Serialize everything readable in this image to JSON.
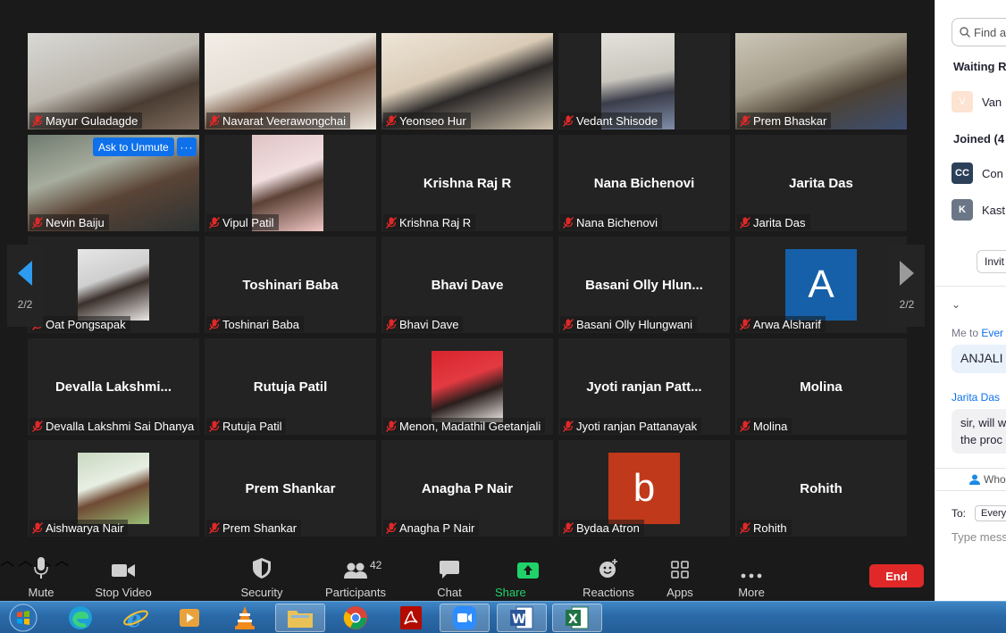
{
  "meeting": {
    "ask_to_unmute": "Ask to Unmute",
    "more_dots": "···",
    "page_left": "2/2",
    "page_right": "2/2"
  },
  "tiles": [
    {
      "name": "Mayur Guladagde",
      "big": "",
      "kind": "video"
    },
    {
      "name": "Navarat Veerawongchai",
      "big": "",
      "kind": "video"
    },
    {
      "name": "Yeonseo Hur",
      "big": "",
      "kind": "video"
    },
    {
      "name": "Vedant Shisode",
      "big": "",
      "kind": "video"
    },
    {
      "name": "Prem Bhaskar",
      "big": "",
      "kind": "video"
    },
    {
      "name": "Nevin Baiju",
      "big": "",
      "kind": "video"
    },
    {
      "name": "Vipul Patil",
      "big": "",
      "kind": "photo"
    },
    {
      "name": "Krishna Raj R",
      "big": "Krishna Raj R",
      "kind": "text"
    },
    {
      "name": "Nana Bichenovi",
      "big": "Nana Bichenovi",
      "kind": "text"
    },
    {
      "name": "Jarita Das",
      "big": "Jarita Das",
      "kind": "text"
    },
    {
      "name": "Oat Pongsapak",
      "big": "",
      "kind": "photo"
    },
    {
      "name": "Toshinari Baba",
      "big": "Toshinari Baba",
      "kind": "text"
    },
    {
      "name": "Bhavi Dave",
      "big": "Bhavi Dave",
      "kind": "text"
    },
    {
      "name": "Basani Olly Hlungwani",
      "big": "Basani  Olly  Hlun...",
      "kind": "text"
    },
    {
      "name": "Arwa Alsharif",
      "big": "A",
      "kind": "letter",
      "color": "#1560a8"
    },
    {
      "name": "Devalla Lakshmi Sai Dhanya",
      "big": "Devalla  Lakshmi...",
      "kind": "text"
    },
    {
      "name": "Rutuja Patil",
      "big": "Rutuja Patil",
      "kind": "text"
    },
    {
      "name": "Menon, Madathil Geetanjali",
      "big": "",
      "kind": "photo"
    },
    {
      "name": "Jyoti ranjan Pattanayak",
      "big": "Jyoti  ranjan  Patt...",
      "kind": "text"
    },
    {
      "name": "Molina",
      "big": "Molina",
      "kind": "text"
    },
    {
      "name": "Aishwarya Nair",
      "big": "",
      "kind": "photo"
    },
    {
      "name": "Prem Shankar",
      "big": "Prem Shankar",
      "kind": "text"
    },
    {
      "name": "Anagha P Nair",
      "big": "Anagha P Nair",
      "kind": "text"
    },
    {
      "name": "Bydaa Atron",
      "big": "b",
      "kind": "letter",
      "color": "#c0391b"
    },
    {
      "name": "Rohith",
      "big": "Rohith",
      "kind": "text"
    }
  ],
  "toolbar": {
    "mute": "Mute",
    "stop_video": "Stop Video",
    "security": "Security",
    "participants": "Participants",
    "participants_count": "42",
    "chat": "Chat",
    "share_screen": "Share Screen",
    "reactions": "Reactions",
    "apps": "Apps",
    "more": "More",
    "end": "End",
    "share_color": "#1fd36a",
    "end_color": "#e02828"
  },
  "panel": {
    "search_placeholder": "Find a",
    "waiting_heading": "Waiting R",
    "waiting_user": "Van",
    "joined_heading": "Joined (4",
    "joined": [
      {
        "initials": "CC",
        "name": "Con",
        "color": "#2d4059"
      },
      {
        "initials": "K",
        "name": "Kast",
        "color": "#6b7787"
      }
    ],
    "invite": "Invit",
    "msg1_from": "Me to",
    "msg1_to": "Ever",
    "msg1_text": "ANJALI",
    "msg2_from": "Jarita Das",
    "msg2_line1": "sir, will w",
    "msg2_line2": "the proc",
    "who": "Who",
    "to_label": "To:",
    "to_value": "Everyo",
    "type_placeholder": "Type mess"
  },
  "taskbar": {
    "apps": [
      "Edge",
      "Internet Explorer",
      "Media Player",
      "VLC",
      "File Explorer",
      "Chrome",
      "Acrobat",
      "Zoom",
      "Word",
      "Excel"
    ]
  }
}
